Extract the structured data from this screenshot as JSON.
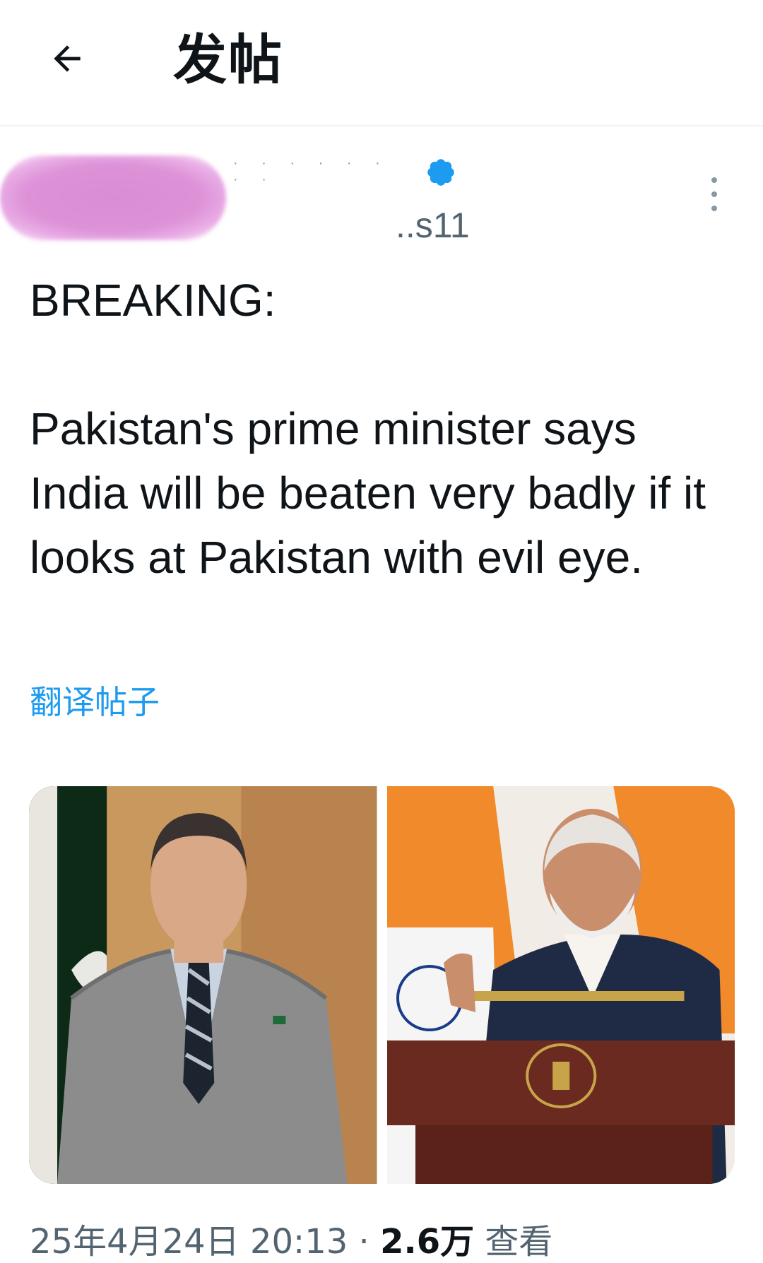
{
  "header": {
    "title": "发帖"
  },
  "author": {
    "handle_partial": "..s11"
  },
  "tweet": {
    "line1": "BREAKING:",
    "line2": "Pakistan's prime minister says India will be beaten very badly if it looks at Pakistan with evil eye.",
    "translate_label": "翻译帖子"
  },
  "meta": {
    "timestamp": "25年4月24日 20:13 ·",
    "views_count": "2.6万",
    "views_label": "查看"
  },
  "colors": {
    "link": "#1d9bf0",
    "secondary_text": "#536471",
    "verified": "#1d9bf0"
  },
  "icons": {
    "back": "arrow-left-icon",
    "verified": "verified-badge-icon",
    "more": "more-vertical-icon"
  }
}
